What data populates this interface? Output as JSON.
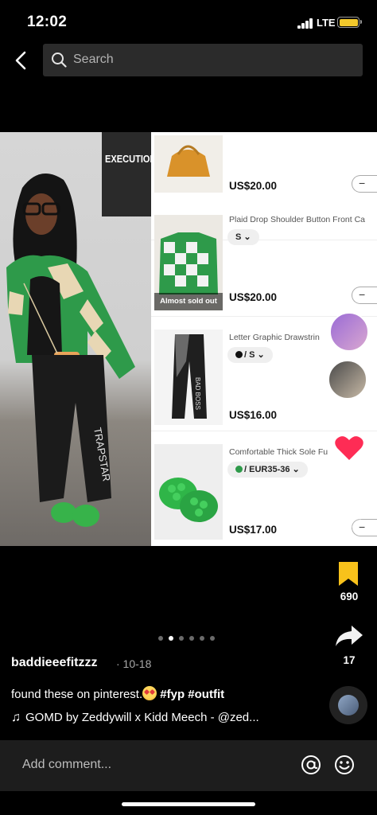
{
  "status_bar": {
    "time": "12:02",
    "network": "LTE"
  },
  "header": {
    "search_placeholder": "Search"
  },
  "media": {
    "poster_text": "EXECUTION",
    "products": [
      {
        "title": "",
        "variant": "",
        "price": "US$20.00",
        "badge": ""
      },
      {
        "title": "Plaid Drop Shoulder Button Front Ca",
        "variant": "S",
        "price": "US$20.00",
        "badge": "Almost sold out"
      },
      {
        "title": "Letter Graphic Drawstrin",
        "variant": "/ S",
        "price": "US$16.00",
        "badge": ""
      },
      {
        "title": "Comfortable Thick Sole Fu",
        "variant": "/ EUR35-36",
        "price": "US$17.00",
        "badge": ""
      }
    ]
  },
  "actions": {
    "bookmark_count": "690",
    "share_count": "17"
  },
  "post": {
    "username": "baddieeefitzzz",
    "date": "· 10-18",
    "caption": "found these on pinterest.",
    "hashtags": " #fyp #outfit",
    "music": "GOMD by Zeddywill x Kidd Meech - @zed..."
  },
  "comment_bar": {
    "placeholder": "Add comment..."
  },
  "pagination": {
    "total": 6,
    "active": 1
  },
  "colors": {
    "accent": "#fe2c55",
    "bookmark": "#f8c21b",
    "plaid_green": "#2e9a4a"
  }
}
